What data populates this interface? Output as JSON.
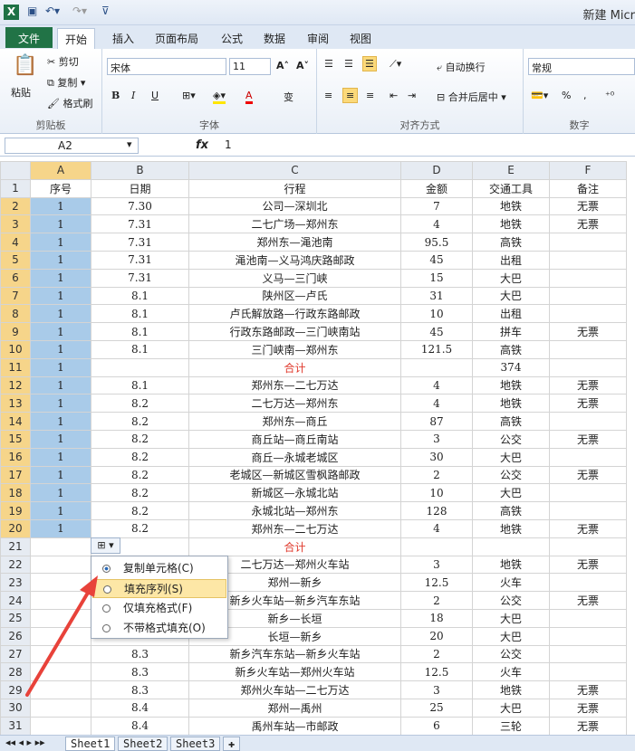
{
  "window": {
    "title": "新建 Micr"
  },
  "ribbon_tabs": [
    "文件",
    "开始",
    "插入",
    "页面布局",
    "公式",
    "数据",
    "审阅",
    "视图"
  ],
  "ribbon": {
    "clipboard": {
      "paste": "粘贴",
      "cut": "剪切",
      "copy": "复制",
      "format_painter": "格式刷",
      "label": "剪贴板"
    },
    "font": {
      "name": "宋体",
      "size": "11",
      "label": "字体",
      "bold": "B",
      "italic": "I",
      "underline": "U",
      "grow": "A˄",
      "shrink": "A˅",
      "font_color": "A",
      "phonetic": "变"
    },
    "align": {
      "wrap": "自动换行",
      "merge": "合并后居中",
      "label": "对齐方式"
    },
    "number": {
      "format": "常规",
      "label": "数字",
      "percent": "%",
      "comma": ","
    }
  },
  "formula_bar": {
    "cell": "A2",
    "fx": "fx",
    "value": "1"
  },
  "columns": [
    "A",
    "B",
    "C",
    "D",
    "E",
    "F"
  ],
  "rows": [
    {
      "n": "1",
      "a": "序号",
      "b": "日期",
      "c": "行程",
      "d": "金额",
      "e": "交通工具",
      "f": "备注"
    },
    {
      "n": "2",
      "a": "1",
      "b": "7.30",
      "c": "公司—深圳北",
      "d": "7",
      "e": "地铁",
      "f": "无票"
    },
    {
      "n": "3",
      "a": "1",
      "b": "7.31",
      "c": "二七广场—郑州东",
      "d": "4",
      "e": "地铁",
      "f": "无票"
    },
    {
      "n": "4",
      "a": "1",
      "b": "7.31",
      "c": "郑州东—渑池南",
      "d": "95.5",
      "e": "高铁",
      "f": ""
    },
    {
      "n": "5",
      "a": "1",
      "b": "7.31",
      "c": "渑池南—义马鸿庆路邮政",
      "d": "45",
      "e": "出租",
      "f": ""
    },
    {
      "n": "6",
      "a": "1",
      "b": "7.31",
      "c": "义马—三门峡",
      "d": "15",
      "e": "大巴",
      "f": ""
    },
    {
      "n": "7",
      "a": "1",
      "b": "8.1",
      "c": "陕州区—卢氏",
      "d": "31",
      "e": "大巴",
      "f": ""
    },
    {
      "n": "8",
      "a": "1",
      "b": "8.1",
      "c": "卢氏解放路—行政东路邮政",
      "d": "10",
      "e": "出租",
      "f": ""
    },
    {
      "n": "9",
      "a": "1",
      "b": "8.1",
      "c": "行政东路邮政—三门峡南站",
      "d": "45",
      "e": "拼车",
      "f": "无票"
    },
    {
      "n": "10",
      "a": "1",
      "b": "8.1",
      "c": "三门峡南—郑州东",
      "d": "121.5",
      "e": "高铁",
      "f": ""
    },
    {
      "n": "11",
      "a": "1",
      "b": "",
      "c": "合计",
      "d": "",
      "e": "374",
      "f": ""
    },
    {
      "n": "12",
      "a": "1",
      "b": "8.1",
      "c": "郑州东—二七万达",
      "d": "4",
      "e": "地铁",
      "f": "无票"
    },
    {
      "n": "13",
      "a": "1",
      "b": "8.2",
      "c": "二七万达—郑州东",
      "d": "4",
      "e": "地铁",
      "f": "无票"
    },
    {
      "n": "14",
      "a": "1",
      "b": "8.2",
      "c": "郑州东—商丘",
      "d": "87",
      "e": "高铁",
      "f": ""
    },
    {
      "n": "15",
      "a": "1",
      "b": "8.2",
      "c": "商丘站—商丘南站",
      "d": "3",
      "e": "公交",
      "f": "无票"
    },
    {
      "n": "16",
      "a": "1",
      "b": "8.2",
      "c": "商丘—永城老城区",
      "d": "30",
      "e": "大巴",
      "f": ""
    },
    {
      "n": "17",
      "a": "1",
      "b": "8.2",
      "c": "老城区—新城区雪枫路邮政",
      "d": "2",
      "e": "公交",
      "f": "无票"
    },
    {
      "n": "18",
      "a": "1",
      "b": "8.2",
      "c": "新城区—永城北站",
      "d": "10",
      "e": "大巴",
      "f": ""
    },
    {
      "n": "19",
      "a": "1",
      "b": "8.2",
      "c": "永城北站—郑州东",
      "d": "128",
      "e": "高铁",
      "f": ""
    },
    {
      "n": "20",
      "a": "1",
      "b": "8.2",
      "c": "郑州东—二七万达",
      "d": "4",
      "e": "地铁",
      "f": "无票"
    },
    {
      "n": "21",
      "a": "",
      "b": "",
      "c": "合计",
      "d": "",
      "e": "",
      "f": ""
    },
    {
      "n": "22",
      "a": "",
      "b": "",
      "c": "二七万达—郑州火车站",
      "d": "3",
      "e": "地铁",
      "f": "无票"
    },
    {
      "n": "23",
      "a": "",
      "b": "",
      "c": "郑州—新乡",
      "d": "12.5",
      "e": "火车",
      "f": ""
    },
    {
      "n": "24",
      "a": "",
      "b": "",
      "c": "新乡火车站—新乡汽车东站",
      "d": "2",
      "e": "公交",
      "f": "无票"
    },
    {
      "n": "25",
      "a": "",
      "b": "",
      "c": "新乡—长垣",
      "d": "18",
      "e": "大巴",
      "f": ""
    },
    {
      "n": "26",
      "a": "",
      "b": "",
      "c": "长垣—新乡",
      "d": "20",
      "e": "大巴",
      "f": ""
    },
    {
      "n": "27",
      "a": "",
      "b": "8.3",
      "c": "新乡汽车东站—新乡火车站",
      "d": "2",
      "e": "公交",
      "f": ""
    },
    {
      "n": "28",
      "a": "",
      "b": "8.3",
      "c": "新乡火车站—郑州火车站",
      "d": "12.5",
      "e": "火车",
      "f": ""
    },
    {
      "n": "29",
      "a": "",
      "b": "8.3",
      "c": "郑州火车站—二七万达",
      "d": "3",
      "e": "地铁",
      "f": "无票"
    },
    {
      "n": "30",
      "a": "",
      "b": "8.4",
      "c": "郑州—禹州",
      "d": "25",
      "e": "大巴",
      "f": "无票"
    },
    {
      "n": "31",
      "a": "",
      "b": "8.4",
      "c": "禹州车站—市邮政",
      "d": "6",
      "e": "三轮",
      "f": "无票"
    }
  ],
  "autofill_menu": {
    "items": [
      "复制单元格(C)",
      "填充序列(S)",
      "仅填充格式(F)",
      "不带格式填充(O)"
    ],
    "selected_index": 0,
    "hover_index": 1
  },
  "sheet_tabs": [
    "Sheet1",
    "Sheet2",
    "Sheet3"
  ],
  "colors": {
    "selection": "#a9cbe9",
    "accent_red": "#e03a2d",
    "file_tab": "#217346",
    "arrow": "#e8423a"
  }
}
